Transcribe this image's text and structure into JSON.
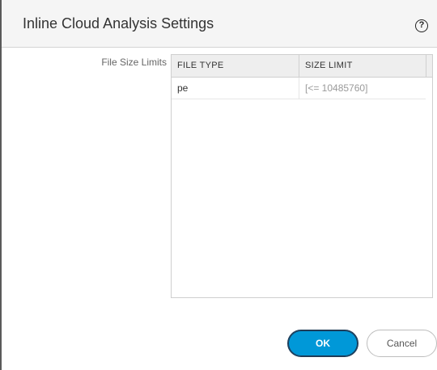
{
  "dialog": {
    "title": "Inline Cloud Analysis Settings",
    "help_icon": "?"
  },
  "form": {
    "file_size_limits_label": "File Size Limits"
  },
  "table": {
    "columns": [
      "FILE TYPE",
      "SIZE LIMIT"
    ],
    "rows": [
      {
        "file_type": "pe",
        "size_limit": "[<= 10485760]"
      }
    ]
  },
  "footer": {
    "ok_label": "OK",
    "cancel_label": "Cancel"
  },
  "colors": {
    "accent": "#0098d8",
    "header_bg": "#f5f5f5",
    "table_header_bg": "#eeeeee"
  }
}
